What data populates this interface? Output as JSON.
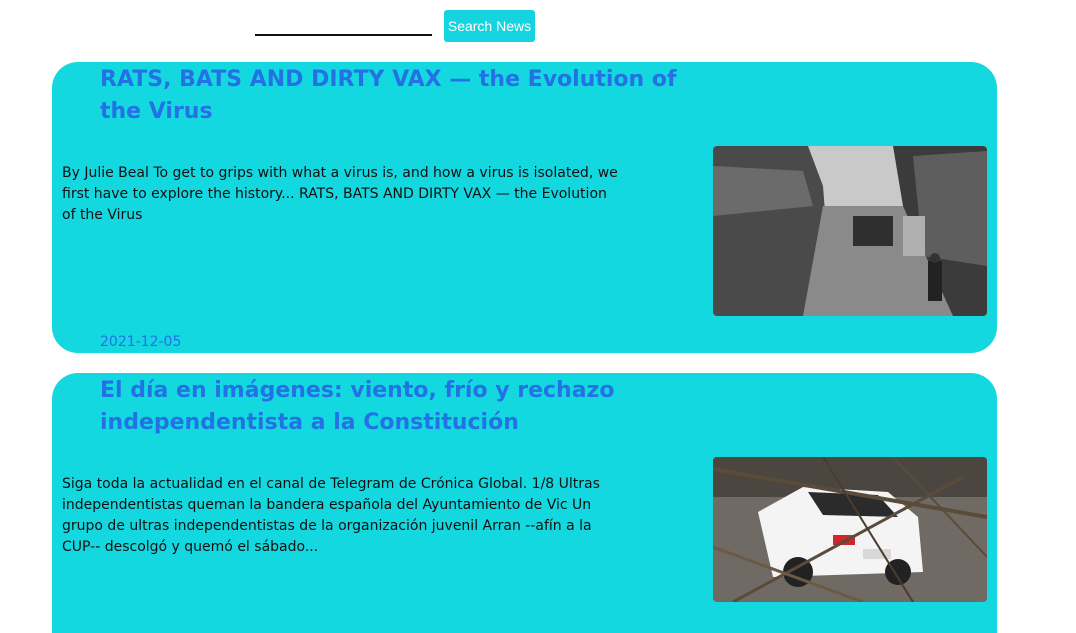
{
  "search": {
    "input_value": "",
    "button_label": "Search News"
  },
  "articles": [
    {
      "title": "RATS, BATS AND DIRTY VAX — the Evolution of the Virus",
      "excerpt": "By Julie Beal To get to grips with what a virus is, and how a virus is isolated, we first have to explore the history... RATS, BATS AND DIRTY VAX — the Evolution of the Virus",
      "date": "2021-12-05"
    },
    {
      "title": "El día en imágenes: viento, frío y rechazo independentista a la Constitución",
      "excerpt": "Siga toda la actualidad en el canal de Telegram de Crónica Global. 1/8 Ultras independentistas queman la bandera española del Ayuntamiento de Vic Un grupo de ultras independentistas de la organización juvenil Arran --afín a la CUP-- descolgó y quemó el sábado..."
    }
  ],
  "colors": {
    "card_background": "#14d8e0",
    "title_color": "#2471e6",
    "button_background": "#15d4df"
  }
}
